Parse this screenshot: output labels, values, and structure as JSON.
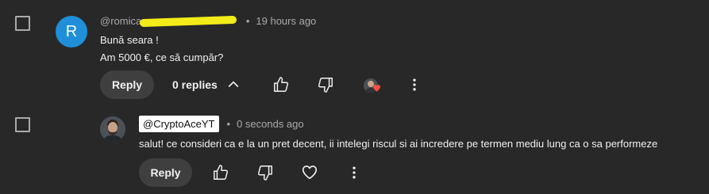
{
  "comment": {
    "author": "@romica",
    "time": "19 hours ago",
    "avatar_letter": "R",
    "lines": [
      "Bună seara !",
      "Am 5000 €, ce să cumpăr?"
    ],
    "reply_label": "Reply",
    "replies_label": "0 replies"
  },
  "reply": {
    "author": "@CryptoAceYT",
    "time": "0 seconds ago",
    "text": "salut! ce consideri ca e la un pret decent, ii intelegi riscul si ai incredere pe termen mediu lung ca o sa performeze",
    "reply_label": "Reply"
  },
  "separator": "•",
  "colors": {
    "background": "#282828",
    "avatar": "#1e8fd8",
    "heart": "#ff4e45",
    "redaction": "#f3ec19"
  }
}
